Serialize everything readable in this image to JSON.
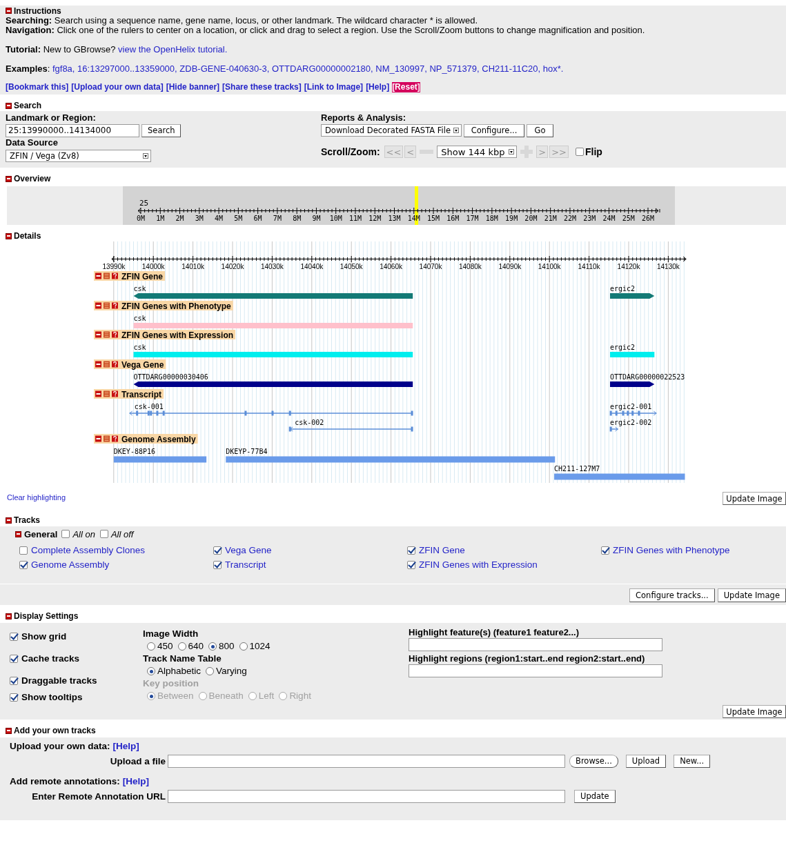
{
  "instructions": {
    "title": "Instructions",
    "expanded": true,
    "lines": [
      "**Searching:** Search using a sequence name, gene name, locus, or other landmark. The wildcard character * is allowed.",
      "**Navigation:** Click one of the rulers to center on a location, or click and drag to select a region. Use the Scroll/Zoom buttons to change magnification and position."
    ],
    "tutorial": {
      "text": "**Tutorial:** New to GBrowse?",
      "link": "view the OpenHelix tutorial."
    },
    "examples": {
      "label": "**Examples**:",
      "links": [
        "fgf8a,",
        "16:13297000..13359000,",
        "ZDB-GENE-040630-3,",
        "OTTDARG00000002180,",
        "NM_130997,",
        "NP_571379,",
        "CH211-11C20,",
        "hox*."
      ]
    },
    "actions": [
      {
        "label": "[Bookmark this]",
        "kind": "link"
      },
      {
        "label": "[Upload your own data]",
        "kind": "link"
      },
      {
        "label": "[Hide banner]",
        "kind": "link"
      },
      {
        "label": "[Share these tracks]",
        "kind": "link"
      },
      {
        "label": "[Link to Image]",
        "kind": "link"
      },
      {
        "label": "[Help]",
        "kind": "link"
      },
      {
        "label": "[Reset]",
        "kind": "reset"
      }
    ]
  },
  "search": {
    "title": "Search",
    "expanded": true,
    "landmark": {
      "label": "Landmark or Region:",
      "value": "25:13990000..14134000",
      "button": "Search"
    },
    "data_source": {
      "label": "Data Source",
      "value": "ZFIN / Vega (Zv8)"
    },
    "reports": {
      "label": "Reports & Analysis:",
      "value": "Download Decorated FASTA File",
      "buttons": [
        "Configure...",
        "Go"
      ]
    },
    "scroll_zoom": {
      "label": "Scroll/Zoom:",
      "back_buttons": [
        "<<",
        "<"
      ],
      "zoom_value": "Show 144 kbp",
      "forward_buttons": [
        ">",
        ">>"
      ],
      "flip": {
        "label": "Flip",
        "checked": false
      }
    }
  },
  "overview": {
    "title": "Overview",
    "expanded": true,
    "chromosome": "25",
    "ticks": [
      "0M",
      "1M",
      "2M",
      "3M",
      "4M",
      "5M",
      "6M",
      "7M",
      "8M",
      "9M",
      "10M",
      "11M",
      "12M",
      "13M",
      "14M",
      "15M",
      "16M",
      "17M",
      "18M",
      "19M",
      "20M",
      "21M",
      "22M",
      "23M",
      "24M",
      "25M",
      "26M"
    ]
  },
  "details": {
    "title": "Details",
    "expanded": true,
    "ruler": [
      "13990k",
      "14000k",
      "14010k",
      "14020k",
      "14030k",
      "14040k",
      "14050k",
      "14060k",
      "14070k",
      "14080k",
      "14090k",
      "14100k",
      "14110k",
      "14120k",
      "14130k"
    ],
    "tracks": [
      {
        "name": "ZFIN Gene",
        "kind": "gene",
        "color": "#137a76",
        "features": [
          {
            "label": "csk",
            "kind": "left-arrow"
          },
          {
            "label": "ergic2",
            "kind": "right-arrow"
          }
        ]
      },
      {
        "name": "ZFIN Genes with Phenotype",
        "kind": "gene",
        "color": "#ffc0cb",
        "features": [
          {
            "label": "csk",
            "kind": "plain"
          }
        ]
      },
      {
        "name": "ZFIN Genes with Expression",
        "kind": "gene",
        "color": "#00eeee",
        "features": [
          {
            "label": "csk",
            "kind": "plain"
          },
          {
            "label": "ergic2",
            "kind": "plain"
          }
        ]
      },
      {
        "name": "Vega Gene",
        "kind": "gene",
        "color": "#00008b",
        "features": [
          {
            "label": "OTTDARG00000030406",
            "kind": "left-arrow"
          },
          {
            "label": "OTTDARG00000022523",
            "kind": "right-arrow"
          }
        ]
      },
      {
        "name": "Transcript",
        "kind": "transcript",
        "color": "#5b8ed8",
        "features": [
          {
            "label": "csk-001",
            "kind": "left-arrow"
          },
          {
            "label": "csk-002",
            "kind": "left-arrow"
          },
          {
            "label": "ergic2-001",
            "kind": "right-arrow"
          },
          {
            "label": "ergic2-002",
            "kind": "right-arrow"
          }
        ]
      },
      {
        "name": "Genome Assembly",
        "kind": "clone",
        "color": "#6a9bea",
        "features": [
          {
            "label": "DKEY-88P16"
          },
          {
            "label": "DKEYP-77B4"
          },
          {
            "label": "CH211-127M7"
          }
        ]
      }
    ],
    "clear_link": "Clear highlighting",
    "update_button": "Update Image"
  },
  "tracks": {
    "title": "Tracks",
    "expanded": true,
    "group": {
      "title": "General",
      "expanded": true,
      "all_on": {
        "label": "All on",
        "checked": false
      },
      "all_off": {
        "label": "All off",
        "checked": false
      }
    },
    "items": [
      {
        "label": "Complete Assembly Clones",
        "checked": false
      },
      {
        "label": "Vega Gene",
        "checked": true
      },
      {
        "label": "ZFIN Gene",
        "checked": true
      },
      {
        "label": "ZFIN Genes with Phenotype",
        "checked": true
      },
      {
        "label": "Genome Assembly",
        "checked": true
      },
      {
        "label": "Transcript",
        "checked": true
      },
      {
        "label": "ZFIN Genes with Expression",
        "checked": true
      }
    ],
    "buttons": [
      "Configure tracks...",
      "Update Image"
    ]
  },
  "display_settings": {
    "title": "Display Settings",
    "expanded": true,
    "options": [
      {
        "label": "Show grid",
        "checked": true
      },
      {
        "label": "Cache tracks",
        "checked": true
      },
      {
        "label": "Draggable tracks",
        "checked": true
      },
      {
        "label": "Show tooltips",
        "checked": true
      }
    ],
    "groups": [
      {
        "label": "Image Width",
        "disabled": false,
        "choices": [
          {
            "label": "450",
            "selected": false
          },
          {
            "label": "640",
            "selected": false
          },
          {
            "label": "800",
            "selected": true
          },
          {
            "label": "1024",
            "selected": false
          }
        ]
      },
      {
        "label": "Track Name Table",
        "disabled": false,
        "choices": [
          {
            "label": "Alphabetic",
            "selected": true
          },
          {
            "label": "Varying",
            "selected": false
          }
        ]
      },
      {
        "label": "Key position",
        "disabled": true,
        "choices": [
          {
            "label": "Between",
            "selected": true
          },
          {
            "label": "Beneath",
            "selected": false
          },
          {
            "label": "Left",
            "selected": false
          },
          {
            "label": "Right",
            "selected": false
          }
        ]
      }
    ],
    "highlight_features": {
      "label": "Highlight feature(s) (feature1 feature2...)"
    },
    "highlight_regions": {
      "label": "Highlight regions (region1:start..end region2:start..end)"
    },
    "update_button": "Update Image"
  },
  "add_tracks": {
    "title": "Add your own tracks",
    "expanded": true,
    "upload": {
      "label": "Upload your own data:",
      "help": "[Help]",
      "field_label": "Upload a file",
      "buttons": [
        "Browse...",
        "Upload",
        "New..."
      ]
    },
    "remote": {
      "label": "Add remote annotations:",
      "help": "[Help]",
      "field_label": "Enter Remote Annotation URL",
      "button": "Update"
    }
  }
}
